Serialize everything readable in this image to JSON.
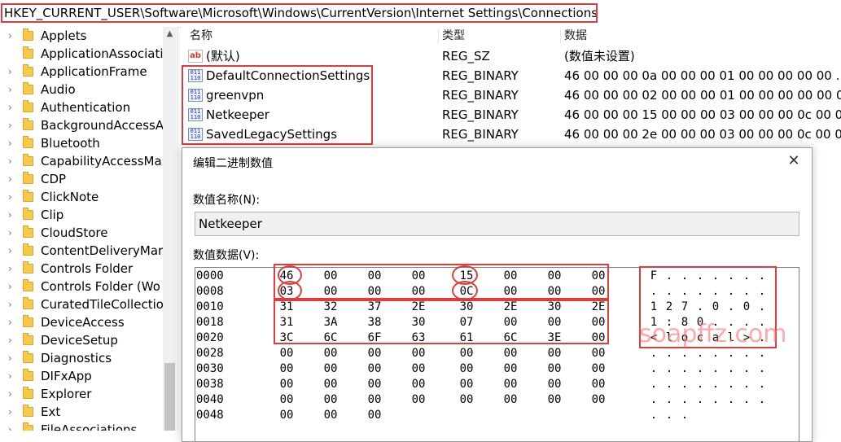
{
  "address_path": "HKEY_CURRENT_USER\\Software\\Microsoft\\Windows\\CurrentVersion\\Internet Settings\\Connections",
  "tree": {
    "items": [
      {
        "label": "Applets",
        "chevron": "›"
      },
      {
        "label": "ApplicationAssociati",
        "chevron": ""
      },
      {
        "label": "ApplicationFrame",
        "chevron": "›"
      },
      {
        "label": "Audio",
        "chevron": "›"
      },
      {
        "label": "Authentication",
        "chevron": "›"
      },
      {
        "label": "BackgroundAccessA",
        "chevron": "›"
      },
      {
        "label": "Bluetooth",
        "chevron": "›"
      },
      {
        "label": "CapabilityAccessMar",
        "chevron": "›"
      },
      {
        "label": "CDP",
        "chevron": "›"
      },
      {
        "label": "ClickNote",
        "chevron": "›"
      },
      {
        "label": "Clip",
        "chevron": "›"
      },
      {
        "label": "CloudStore",
        "chevron": "›"
      },
      {
        "label": "ContentDeliveryMar",
        "chevron": "›"
      },
      {
        "label": "Controls Folder",
        "chevron": "›"
      },
      {
        "label": "Controls Folder (Wo",
        "chevron": "›"
      },
      {
        "label": "CuratedTileCollectio",
        "chevron": "›"
      },
      {
        "label": "DeviceAccess",
        "chevron": "›"
      },
      {
        "label": "DeviceSetup",
        "chevron": "›"
      },
      {
        "label": "Diagnostics",
        "chevron": "›"
      },
      {
        "label": "DIFxApp",
        "chevron": "›"
      },
      {
        "label": "Explorer",
        "chevron": "›"
      },
      {
        "label": "Ext",
        "chevron": "›"
      },
      {
        "label": "FileAssociations",
        "chevron": "›"
      }
    ]
  },
  "values_list": {
    "headers": {
      "name": "名称",
      "type": "类型",
      "data": "数据"
    },
    "rows": [
      {
        "icon": "string-value-icon",
        "icon_text": "ab",
        "name": "(默认)",
        "type": "REG_SZ",
        "data": "(数值未设置)"
      },
      {
        "icon": "binary-value-icon",
        "icon_text": "011\n110",
        "name": "DefaultConnectionSettings",
        "type": "REG_BINARY",
        "data": "46 00 00 00 0a 00 00 00 01 00 00 00 00 00 ..."
      },
      {
        "icon": "binary-value-icon",
        "icon_text": "011\n110",
        "name": "greenvpn",
        "type": "REG_BINARY",
        "data": "46 00 00 00 02 00 00 00 01 00 00 00 00 00 00 ..."
      },
      {
        "icon": "binary-value-icon",
        "icon_text": "011\n110",
        "name": "Netkeeper",
        "type": "REG_BINARY",
        "data": "46 00 00 00 15 00 00 00 03 00 00 00 0c 00 00 ..."
      },
      {
        "icon": "binary-value-icon",
        "icon_text": "011\n110",
        "name": "SavedLegacySettings",
        "type": "REG_BINARY",
        "data": "46 00 00 00 2e 00 00 00 03 00 00 00 0c 00 00 ..."
      }
    ]
  },
  "dialog": {
    "title": "编辑二进制数值",
    "close_glyph": "✕",
    "value_name_label": "数值名称(N):",
    "value_name": "Netkeeper",
    "value_data_label": "数值数据(V):",
    "hex_rows": [
      {
        "offset": "0000",
        "bytes": [
          "46",
          "00",
          "00",
          "00",
          "15",
          "00",
          "00",
          "00"
        ],
        "ascii": [
          "F",
          ".",
          ".",
          ".",
          ".",
          ".",
          ".",
          "."
        ]
      },
      {
        "offset": "0008",
        "bytes": [
          "03",
          "00",
          "00",
          "00",
          "0C",
          "00",
          "00",
          "00"
        ],
        "ascii": [
          ".",
          ".",
          ".",
          ".",
          ".",
          ".",
          ".",
          "."
        ]
      },
      {
        "offset": "0010",
        "bytes": [
          "31",
          "32",
          "37",
          "2E",
          "30",
          "2E",
          "30",
          "2E"
        ],
        "ascii": [
          "1",
          "2",
          "7",
          ".",
          "0",
          ".",
          "0",
          "."
        ]
      },
      {
        "offset": "0018",
        "bytes": [
          "31",
          "3A",
          "38",
          "30",
          "07",
          "00",
          "00",
          "00"
        ],
        "ascii": [
          "1",
          ":",
          "8",
          "0",
          ".",
          ".",
          ".",
          "."
        ]
      },
      {
        "offset": "0020",
        "bytes": [
          "3C",
          "6C",
          "6F",
          "63",
          "61",
          "6C",
          "3E",
          "00"
        ],
        "ascii": [
          "<",
          "l",
          "o",
          "c",
          "a",
          "l",
          ">",
          "."
        ]
      },
      {
        "offset": "0028",
        "bytes": [
          "00",
          "00",
          "00",
          "00",
          "00",
          "00",
          "00",
          "00"
        ],
        "ascii": [
          ".",
          ".",
          ".",
          ".",
          ".",
          ".",
          ".",
          "."
        ]
      },
      {
        "offset": "0030",
        "bytes": [
          "00",
          "00",
          "00",
          "00",
          "00",
          "00",
          "00",
          "00"
        ],
        "ascii": [
          ".",
          ".",
          ".",
          ".",
          ".",
          ".",
          ".",
          "."
        ]
      },
      {
        "offset": "0038",
        "bytes": [
          "00",
          "00",
          "00",
          "00",
          "00",
          "00",
          "00",
          "00"
        ],
        "ascii": [
          ".",
          ".",
          ".",
          ".",
          ".",
          ".",
          ".",
          "."
        ]
      },
      {
        "offset": "0040",
        "bytes": [
          "00",
          "00",
          "00",
          "00",
          "00",
          "00",
          "00",
          "00"
        ],
        "ascii": [
          ".",
          ".",
          ".",
          ".",
          ".",
          ".",
          ".",
          "."
        ]
      },
      {
        "offset": "0048",
        "bytes": [
          "00",
          "00",
          "00"
        ],
        "ascii": [
          ".",
          ".",
          "."
        ]
      }
    ]
  },
  "watermark": "soapffz.com",
  "colors": {
    "annotation_red": "#e23b3b",
    "folder_yellow": "#f6c94a"
  }
}
